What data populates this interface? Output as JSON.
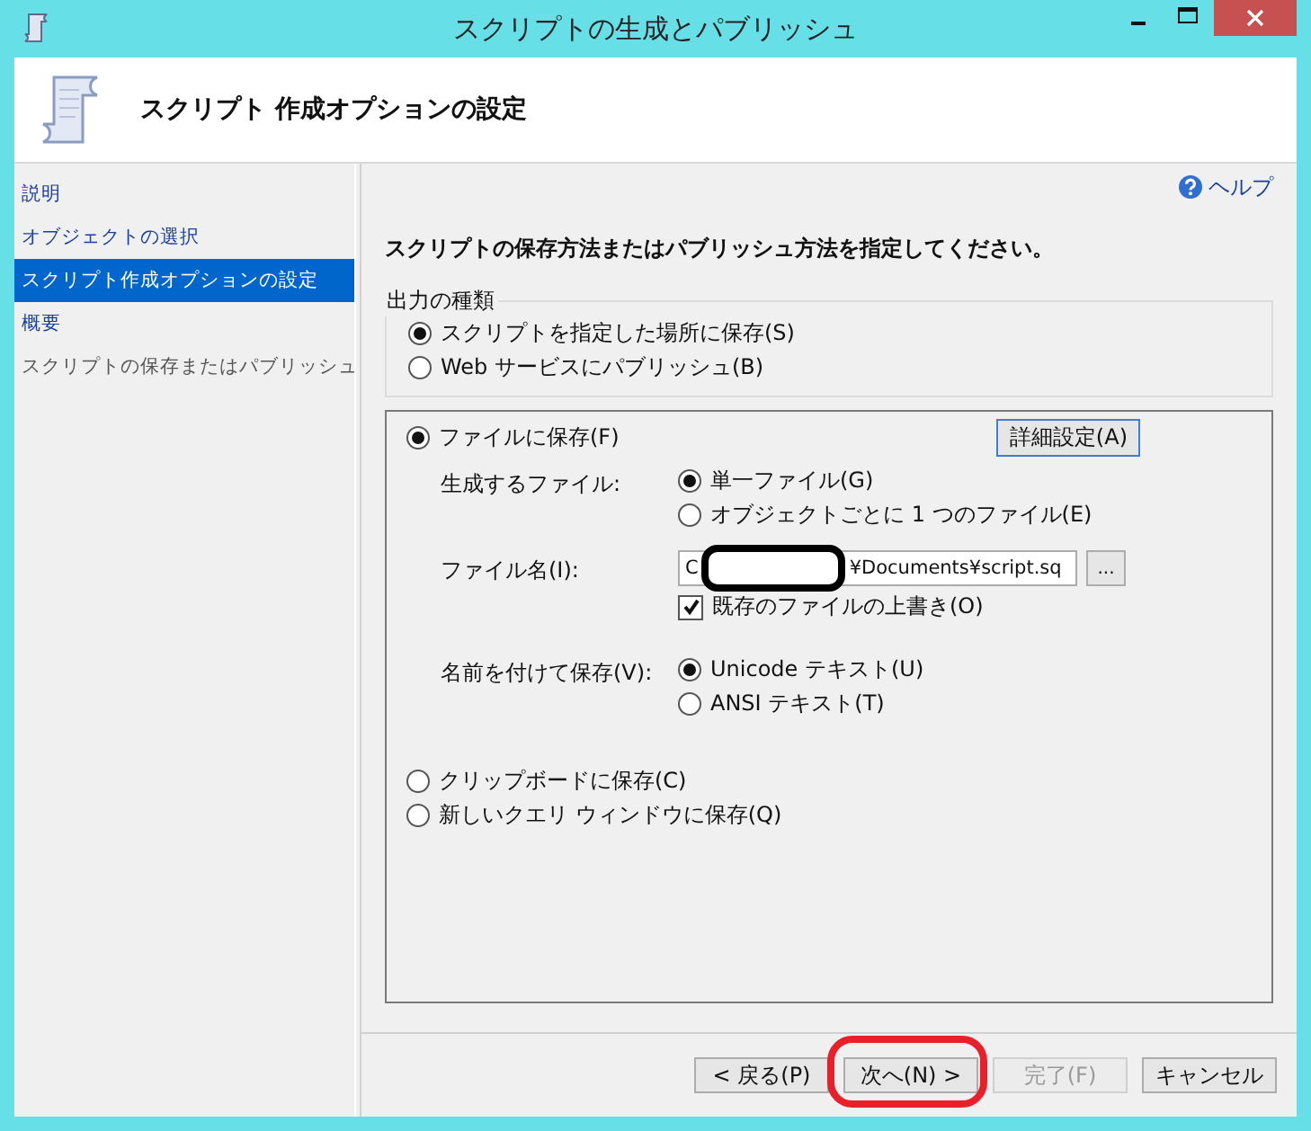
{
  "window": {
    "title": "スクリプトの生成とパブリッシュ"
  },
  "header": {
    "title": "スクリプト 作成オプションの設定"
  },
  "nav": [
    {
      "label": "説明",
      "selected": false,
      "disabled": false
    },
    {
      "label": "オブジェクトの選択",
      "selected": false,
      "disabled": false
    },
    {
      "label": "スクリプト作成オプションの設定",
      "selected": true,
      "disabled": false
    },
    {
      "label": "概要",
      "selected": false,
      "disabled": false
    },
    {
      "label": "スクリプトの保存またはパブリッシュ",
      "selected": false,
      "disabled": true
    }
  ],
  "help": "ヘルプ",
  "instruction": "スクリプトの保存方法またはパブリッシュ方法を指定してください。",
  "output_type": {
    "legend": "出力の種類",
    "options": [
      {
        "label": "スクリプトを指定した場所に保存(S)",
        "selected": true
      },
      {
        "label": "Web サービスにパブリッシュ(B)",
        "selected": false
      }
    ]
  },
  "save_options": [
    {
      "kind": "file",
      "label": "ファイルに保存(F)",
      "selected": true
    },
    {
      "kind": "clipboard",
      "label": "クリップボードに保存(C)",
      "selected": false
    },
    {
      "kind": "query",
      "label": "新しいクエリ ウィンドウに保存(Q)",
      "selected": false
    }
  ],
  "advanced_button": "詳細設定(A)",
  "file_settings": {
    "files_label": "生成するファイル:",
    "files_options": [
      {
        "label": "単一ファイル(G)",
        "selected": true
      },
      {
        "label": "オブジェクトごとに 1 つのファイル(E)",
        "selected": false
      }
    ],
    "file_name_label": "ファイル名(I):",
    "file_name": {
      "start": "C",
      "end": "¥Documents¥script.sq",
      "redacted": true
    },
    "browse": "...",
    "overwrite": {
      "label": "既存のファイルの上書き(O)",
      "checked": true
    },
    "encoding_label": "名前を付けて保存(V):",
    "encoding_options": [
      {
        "label": "Unicode テキスト(U)",
        "selected": true
      },
      {
        "label": "ANSI テキスト(T)",
        "selected": false
      }
    ]
  },
  "buttons": [
    {
      "label": "< 戻る(P)",
      "disabled": false,
      "circled": false
    },
    {
      "label": "次へ(N) >",
      "disabled": false,
      "circled": true
    },
    {
      "label": "完了(F)",
      "disabled": true,
      "circled": false
    },
    {
      "label": "キャンセル",
      "disabled": false,
      "circled": false
    }
  ]
}
